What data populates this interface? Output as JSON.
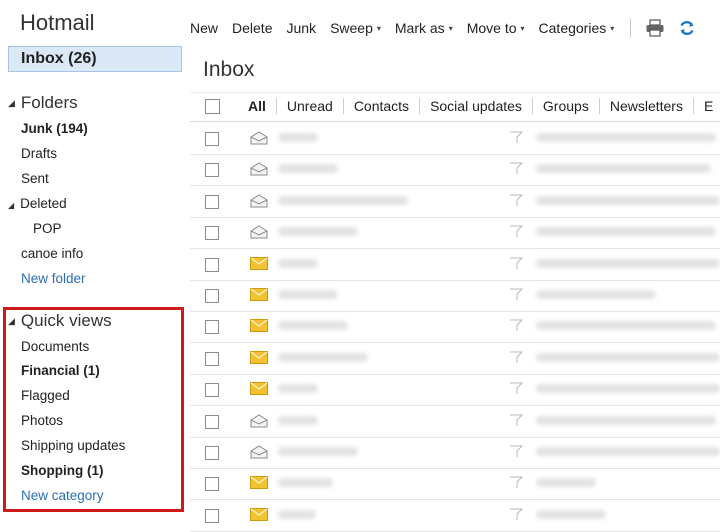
{
  "app": {
    "title": "Hotmail"
  },
  "toolbar": {
    "new": "New",
    "delete": "Delete",
    "junk": "Junk",
    "sweep": "Sweep",
    "mark_as": "Mark as",
    "move_to": "Move to",
    "categories": "Categories",
    "dropdown_glyph": "▾"
  },
  "sidebar": {
    "inbox": "Inbox (26)",
    "folders_header": "Folders",
    "folders": {
      "junk": "Junk (194)",
      "drafts": "Drafts",
      "sent": "Sent",
      "deleted": "Deleted",
      "pop": "POP",
      "canoe": "canoe info",
      "new_folder": "New folder"
    },
    "quick_views_header": "Quick views",
    "quick_views": {
      "documents": "Documents",
      "financial": "Financial  (1)",
      "flagged": "Flagged",
      "photos": "Photos",
      "shipping": "Shipping updates",
      "shopping": "Shopping  (1)",
      "new_category": "New category"
    },
    "expand_glyph": "◢"
  },
  "main": {
    "title": "Inbox",
    "filters": {
      "all": "All",
      "unread": "Unread",
      "contacts": "Contacts",
      "social": "Social updates",
      "groups": "Groups",
      "newsletters": "Newsletters",
      "more": "E"
    }
  },
  "messages": [
    {
      "state": "read",
      "icon": "open-envelope-icon"
    },
    {
      "state": "read",
      "icon": "open-envelope-icon"
    },
    {
      "state": "read",
      "icon": "open-envelope-icon"
    },
    {
      "state": "read",
      "icon": "open-envelope-icon"
    },
    {
      "state": "unread",
      "icon": "closed-envelope-icon"
    },
    {
      "state": "unread",
      "icon": "closed-envelope-icon"
    },
    {
      "state": "unread",
      "icon": "closed-envelope-icon"
    },
    {
      "state": "unread",
      "icon": "closed-envelope-icon"
    },
    {
      "state": "unread",
      "icon": "closed-envelope-icon"
    },
    {
      "state": "read",
      "icon": "open-envelope-icon"
    },
    {
      "state": "read",
      "icon": "open-envelope-icon"
    },
    {
      "state": "unread",
      "icon": "closed-envelope-icon"
    },
    {
      "state": "unread",
      "icon": "closed-envelope-icon"
    }
  ],
  "colors": {
    "link": "#2a6fb5",
    "highlight_box": "#cc1a1a",
    "selected_bg": "#dbe8f5",
    "unread_envelope": "#f2c230",
    "refresh_icon": "#1f78c8"
  }
}
